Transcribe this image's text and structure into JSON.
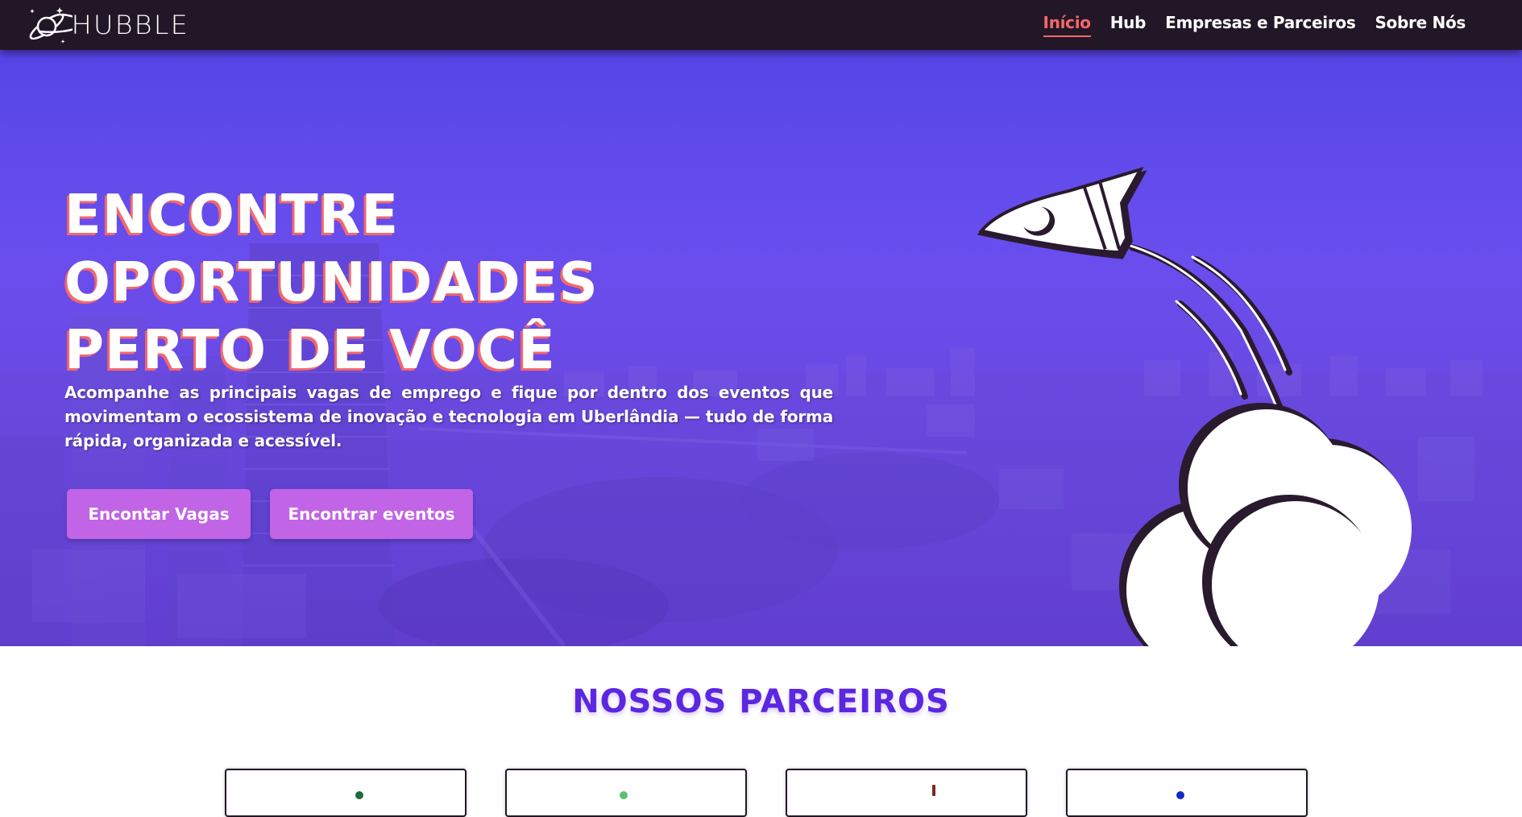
{
  "brand": {
    "name": "HUBBLE",
    "logo_icon": "planet-rocket-logo-icon"
  },
  "nav": {
    "items": [
      {
        "label": "Início",
        "active": true
      },
      {
        "label": "Hub",
        "active": false
      },
      {
        "label": "Empresas e Parceiros",
        "active": false
      },
      {
        "label": "Sobre Nós",
        "active": false
      }
    ]
  },
  "hero": {
    "title_lines": [
      "ENCONTRE",
      "OPORTUNIDADES",
      "PERTO DE VOCÊ"
    ],
    "description": "Acompanhe as principais vagas de emprego e fique por dentro dos eventos que movimentam o ecossistema de inovação e tecnologia em Uberlândia — tudo de forma rápida, organizada e acessível.",
    "buttons": {
      "jobs": "Encontar Vagas",
      "events": "Encontrar eventos"
    },
    "illustration_icon": "rocket-launch-cloud-icon"
  },
  "partners": {
    "title": "NOSSOS PARCEIROS",
    "card_count": 4
  },
  "colors": {
    "navbar": "#221726",
    "accent": "#f4676b",
    "hero_overlay": "#5b45e8",
    "button": "#c164e6",
    "partners_title": "#5b27e0"
  }
}
